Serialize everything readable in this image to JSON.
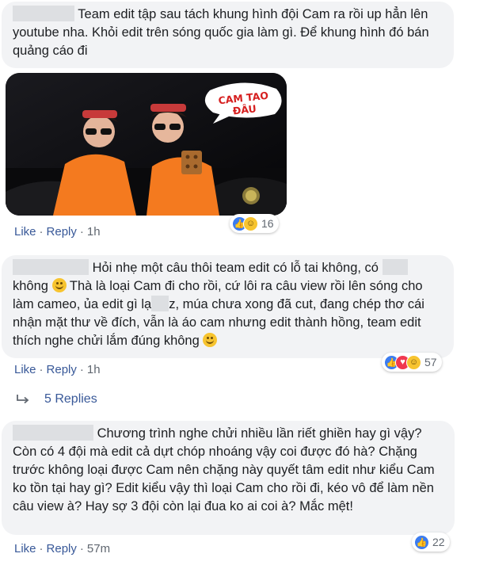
{
  "comments": [
    {
      "text": "Team edit tập sau tách khung hình đội Cam ra rồi up hẳn lên youtube nha. Khỏi edit trên sóng quốc gia làm gì. Để khung hình đó bán quảng cáo đi",
      "reactions_count": "16",
      "reaction_types": [
        "like-icon",
        "haha-icon"
      ]
    },
    {
      "text_1": "Hỏi nhẹ một câu thôi team edit có lỗ tai không, có",
      "text_2": "không",
      "text_3": "Thà là loại Cam đi cho rồi, cứ lôi ra câu view rồi lên sóng cho làm cameo, ủa edit gì lạ",
      "text_4": "z, múa chưa xong đã cut, đang chép thơ cái nhận mặt thư về đích, vẫn là áo cam nhưng edit thành hồng, team edit thích nghe chửi lắm đúng không",
      "reactions_count": "57",
      "reaction_types": [
        "like-icon",
        "love-icon",
        "haha-icon"
      ]
    },
    {
      "text": "Chương trình nghe chửi nhiều lần riết ghiền hay gì vậy? Còn có 4 đội mà edit cả dựt chóp nhoáng vậy coi được đó hà? Chặng trước không loại được Cam nên chặng này quyết tâm edit như kiểu Cam ko tồn tại hay gì? Edit kiểu vậy thì loại Cam cho rồi đi, kéo vô để làm nền câu view à? Hay sợ 3 đội còn lại đua ko ai coi à? Mắc mệt!",
      "reactions_count": "22",
      "reaction_types": [
        "like-icon"
      ]
    }
  ],
  "actions": {
    "like": "Like",
    "reply": "Reply",
    "dot": "·",
    "time_1": "1h",
    "time_2": "1h",
    "time_3": "57m"
  },
  "replies_label": "5 Replies",
  "photo": {
    "sticker_text": "CAM TAO ĐÂU"
  },
  "colors": {
    "bubble": "#f2f3f5",
    "link": "#385898",
    "meta": "#606770",
    "like": "#3b7cf0",
    "love": "#f0384f",
    "haha": "#f7c42f",
    "shirt": "#f47a1f"
  }
}
